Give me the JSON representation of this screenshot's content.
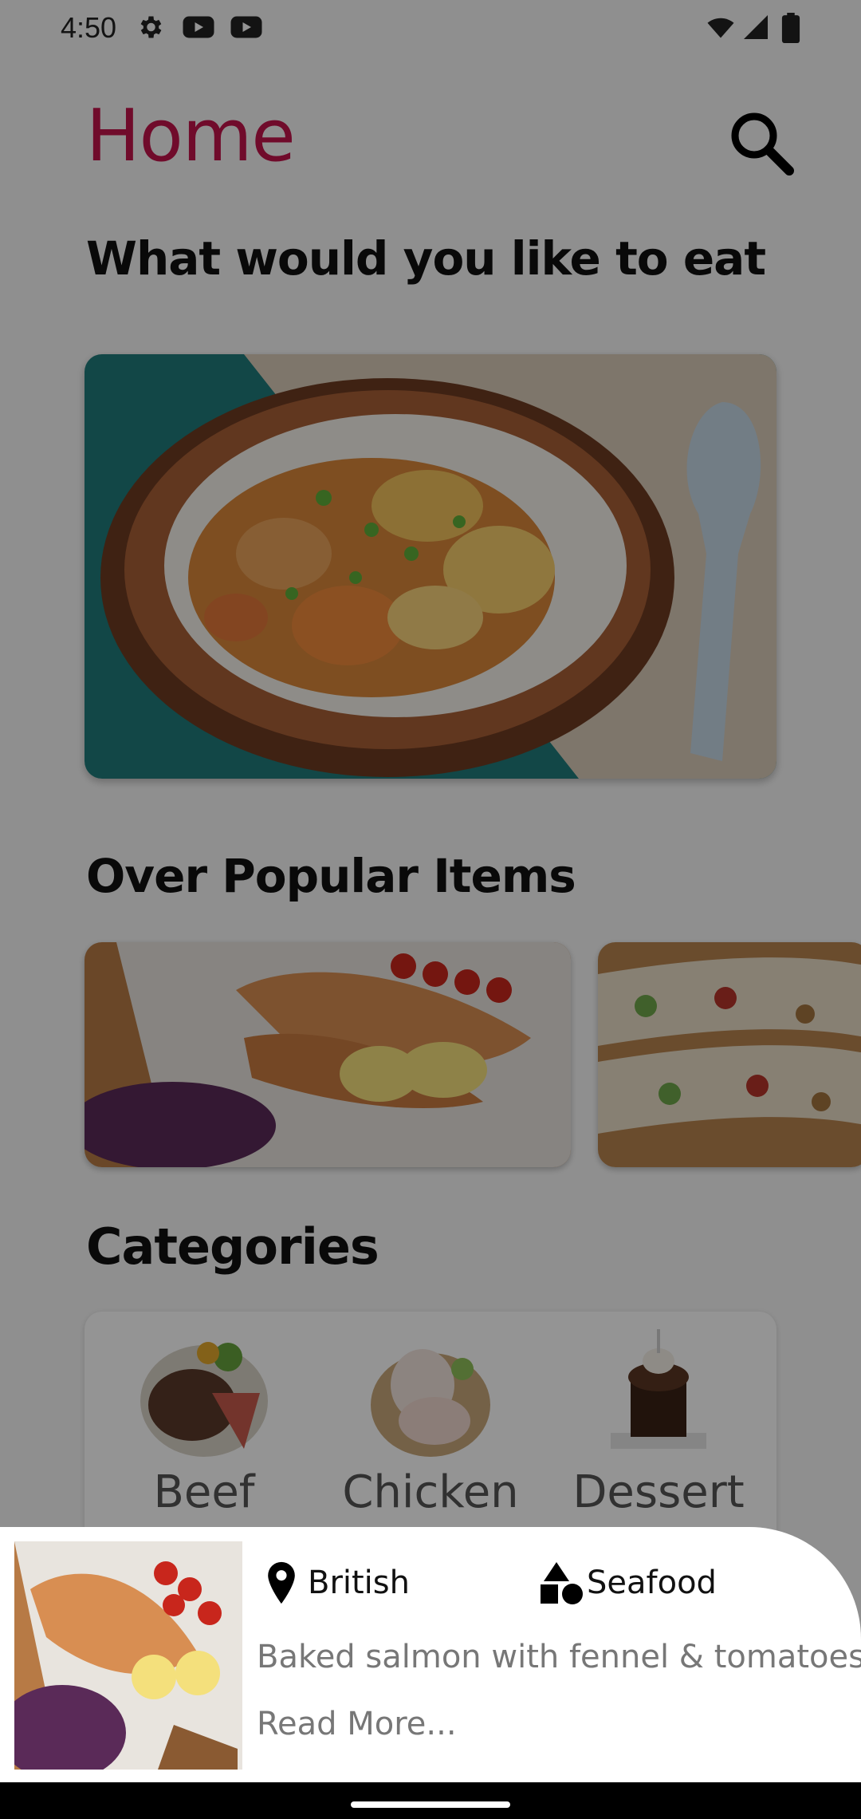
{
  "status_bar": {
    "time": "4:50",
    "left_icons": [
      "gear-icon",
      "youtube-icon",
      "youtube-icon"
    ],
    "right_icons": [
      "wifi-icon",
      "signal-icon",
      "battery-icon"
    ]
  },
  "header": {
    "title": "Home",
    "search_icon": "search-icon"
  },
  "sections": {
    "eat_prompt": "What would you like to eat",
    "popular_title": "Over Popular Items",
    "categories_title": "Categories"
  },
  "categories": [
    {
      "label": "Beef"
    },
    {
      "label": "Chicken"
    },
    {
      "label": "Dessert"
    }
  ],
  "bottom_sheet": {
    "area": "British",
    "area_icon": "location-pin-icon",
    "category": "Seafood",
    "category_icon": "shapes-icon",
    "description": "Baked salmon with fennel & tomatoes",
    "read_more": "Read More..."
  },
  "colors": {
    "brand": "#c2134a",
    "scrim": "rgba(0,0,0,0.42)",
    "sheet_background": "#ffffff"
  }
}
